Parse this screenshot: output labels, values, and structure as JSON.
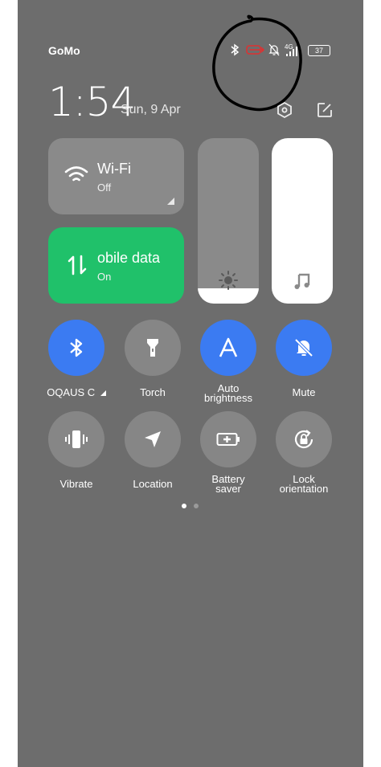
{
  "status_bar": {
    "carrier": "GoMo",
    "network_type": "4G",
    "battery_level": "37",
    "icons": [
      "bluetooth-icon",
      "data-saver-icon",
      "silent-bell-icon",
      "signal-icon",
      "battery-icon"
    ]
  },
  "header": {
    "time": "1:54",
    "date": "Sun, 9 Apr"
  },
  "tiles": {
    "wifi": {
      "title": "Wi-Fi",
      "status": "Off"
    },
    "mobile_data": {
      "title": "obile data",
      "status": "On"
    }
  },
  "sliders": {
    "brightness_level": 0.09,
    "volume_level": 1.0
  },
  "toggles": [
    {
      "label": "OQAUS C",
      "state": "on",
      "icon": "bluetooth-icon"
    },
    {
      "label": "Torch",
      "state": "off",
      "icon": "torch-icon"
    },
    {
      "label": "Auto\nbrightness",
      "state": "on",
      "icon": "auto-brightness-icon"
    },
    {
      "label": "Mute",
      "state": "on",
      "icon": "mute-icon"
    },
    {
      "label": "Vibrate",
      "state": "off",
      "icon": "vibrate-icon"
    },
    {
      "label": "Location",
      "state": "off",
      "icon": "location-icon"
    },
    {
      "label": "Battery\nsaver",
      "state": "off",
      "icon": "battery-saver-icon"
    },
    {
      "label": "Lock\norientation",
      "state": "off",
      "icon": "rotation-lock-icon"
    }
  ],
  "pager": {
    "current_page": 1,
    "page_count": 2
  },
  "colors": {
    "panel": "#6d6d6d",
    "accent_on": "#3b7bf2",
    "mobile_data_on": "#20c16a",
    "tile_off": "#8a8a8a",
    "annotation": "#000000",
    "data_saver": "#e03030"
  }
}
